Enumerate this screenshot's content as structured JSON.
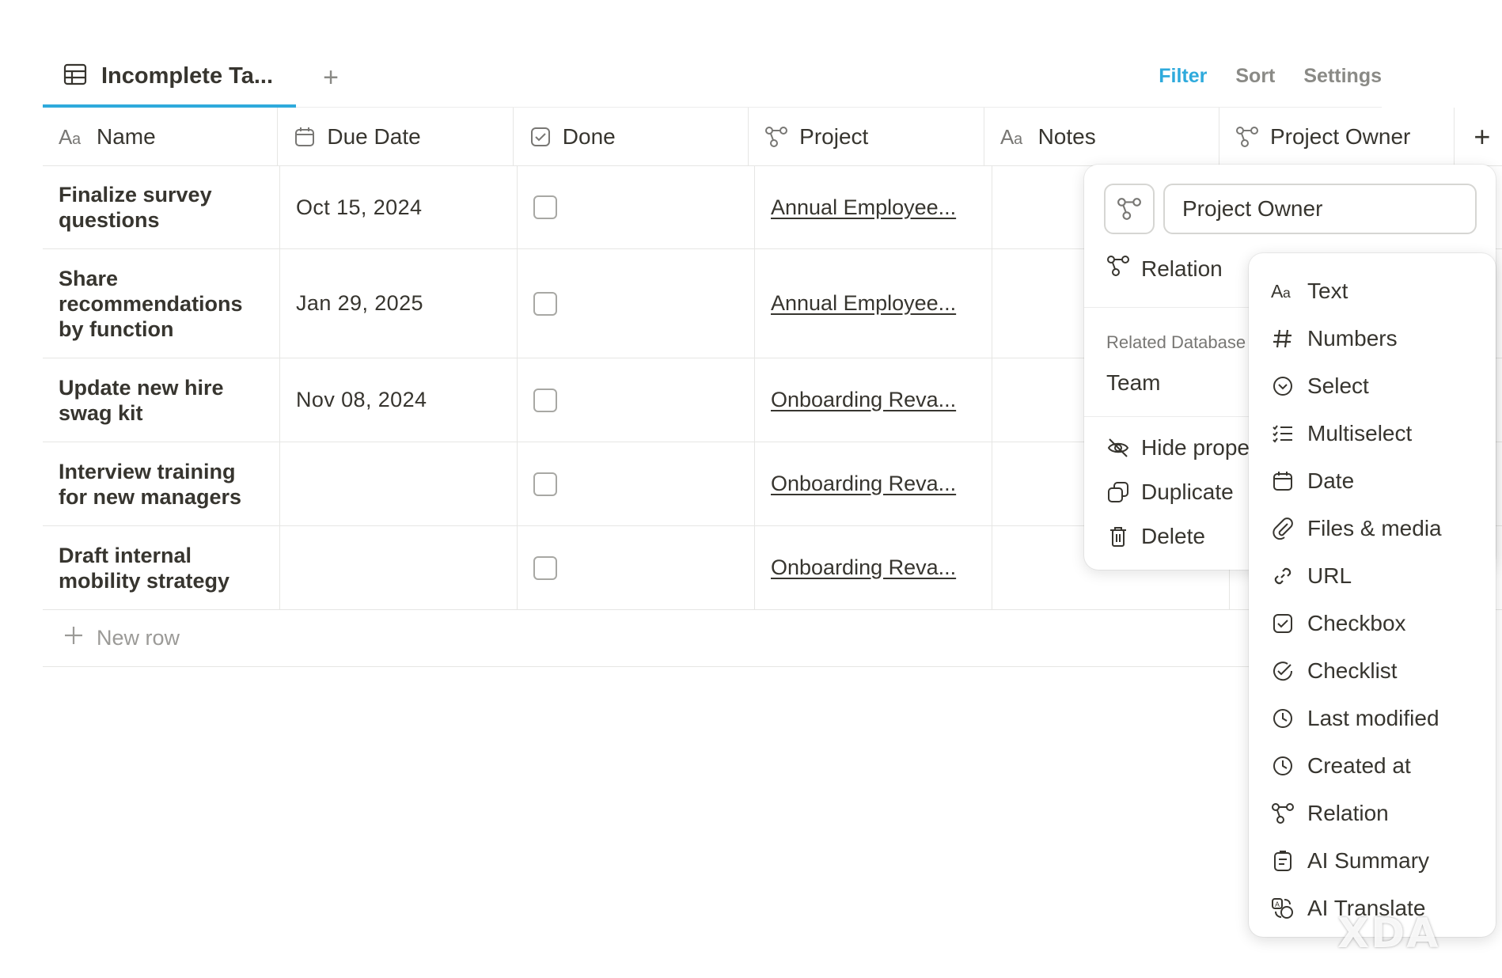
{
  "toolbar": {
    "view_label": "Incomplete Ta...",
    "add_view": "+",
    "filter": "Filter",
    "sort": "Sort",
    "settings": "Settings"
  },
  "columns": [
    {
      "label": "Name",
      "icon": "text-icon"
    },
    {
      "label": "Due Date",
      "icon": "calendar-icon"
    },
    {
      "label": "Done",
      "icon": "checkbox-icon"
    },
    {
      "label": "Project",
      "icon": "relation-icon"
    },
    {
      "label": "Notes",
      "icon": "text-icon"
    },
    {
      "label": "Project Owner",
      "icon": "relation-icon"
    }
  ],
  "add_column": "+",
  "rows": [
    {
      "name": "Finalize survey questions",
      "due": "Oct 15, 2024",
      "done": false,
      "project": "Annual Employee..."
    },
    {
      "name": "Share recommendations by function",
      "due": "Jan 29, 2025",
      "done": false,
      "project": "Annual Employee..."
    },
    {
      "name": "Update new hire swag kit",
      "due": "Nov 08, 2024",
      "done": false,
      "project": "Onboarding Reva..."
    },
    {
      "name": "Interview training for new managers",
      "due": "",
      "done": false,
      "project": "Onboarding Reva..."
    },
    {
      "name": "Draft internal mobility strategy",
      "due": "",
      "done": false,
      "project": "Onboarding Reva..."
    }
  ],
  "new_row": "New row",
  "panel": {
    "property_name": "Project Owner",
    "type_label": "Relation",
    "related_label": "Related Database",
    "related_value": "Team",
    "hide": "Hide property",
    "duplicate": "Duplicate",
    "delete": "Delete"
  },
  "types": [
    {
      "label": "Text",
      "icon": "text-icon"
    },
    {
      "label": "Numbers",
      "icon": "hash-icon"
    },
    {
      "label": "Select",
      "icon": "select-icon"
    },
    {
      "label": "Multiselect",
      "icon": "list-icon"
    },
    {
      "label": "Date",
      "icon": "calendar-icon"
    },
    {
      "label": "Files & media",
      "icon": "paperclip-icon"
    },
    {
      "label": "URL",
      "icon": "link-icon"
    },
    {
      "label": "Checkbox",
      "icon": "checkbox-icon"
    },
    {
      "label": "Checklist",
      "icon": "check-circle-icon"
    },
    {
      "label": "Last modified",
      "icon": "clock-icon"
    },
    {
      "label": "Created at",
      "icon": "clock-icon"
    },
    {
      "label": "Relation",
      "icon": "relation-icon"
    },
    {
      "label": "AI Summary",
      "icon": "ai-summary-icon"
    },
    {
      "label": "AI Translate",
      "icon": "ai-translate-icon"
    }
  ],
  "watermark": "XDA"
}
